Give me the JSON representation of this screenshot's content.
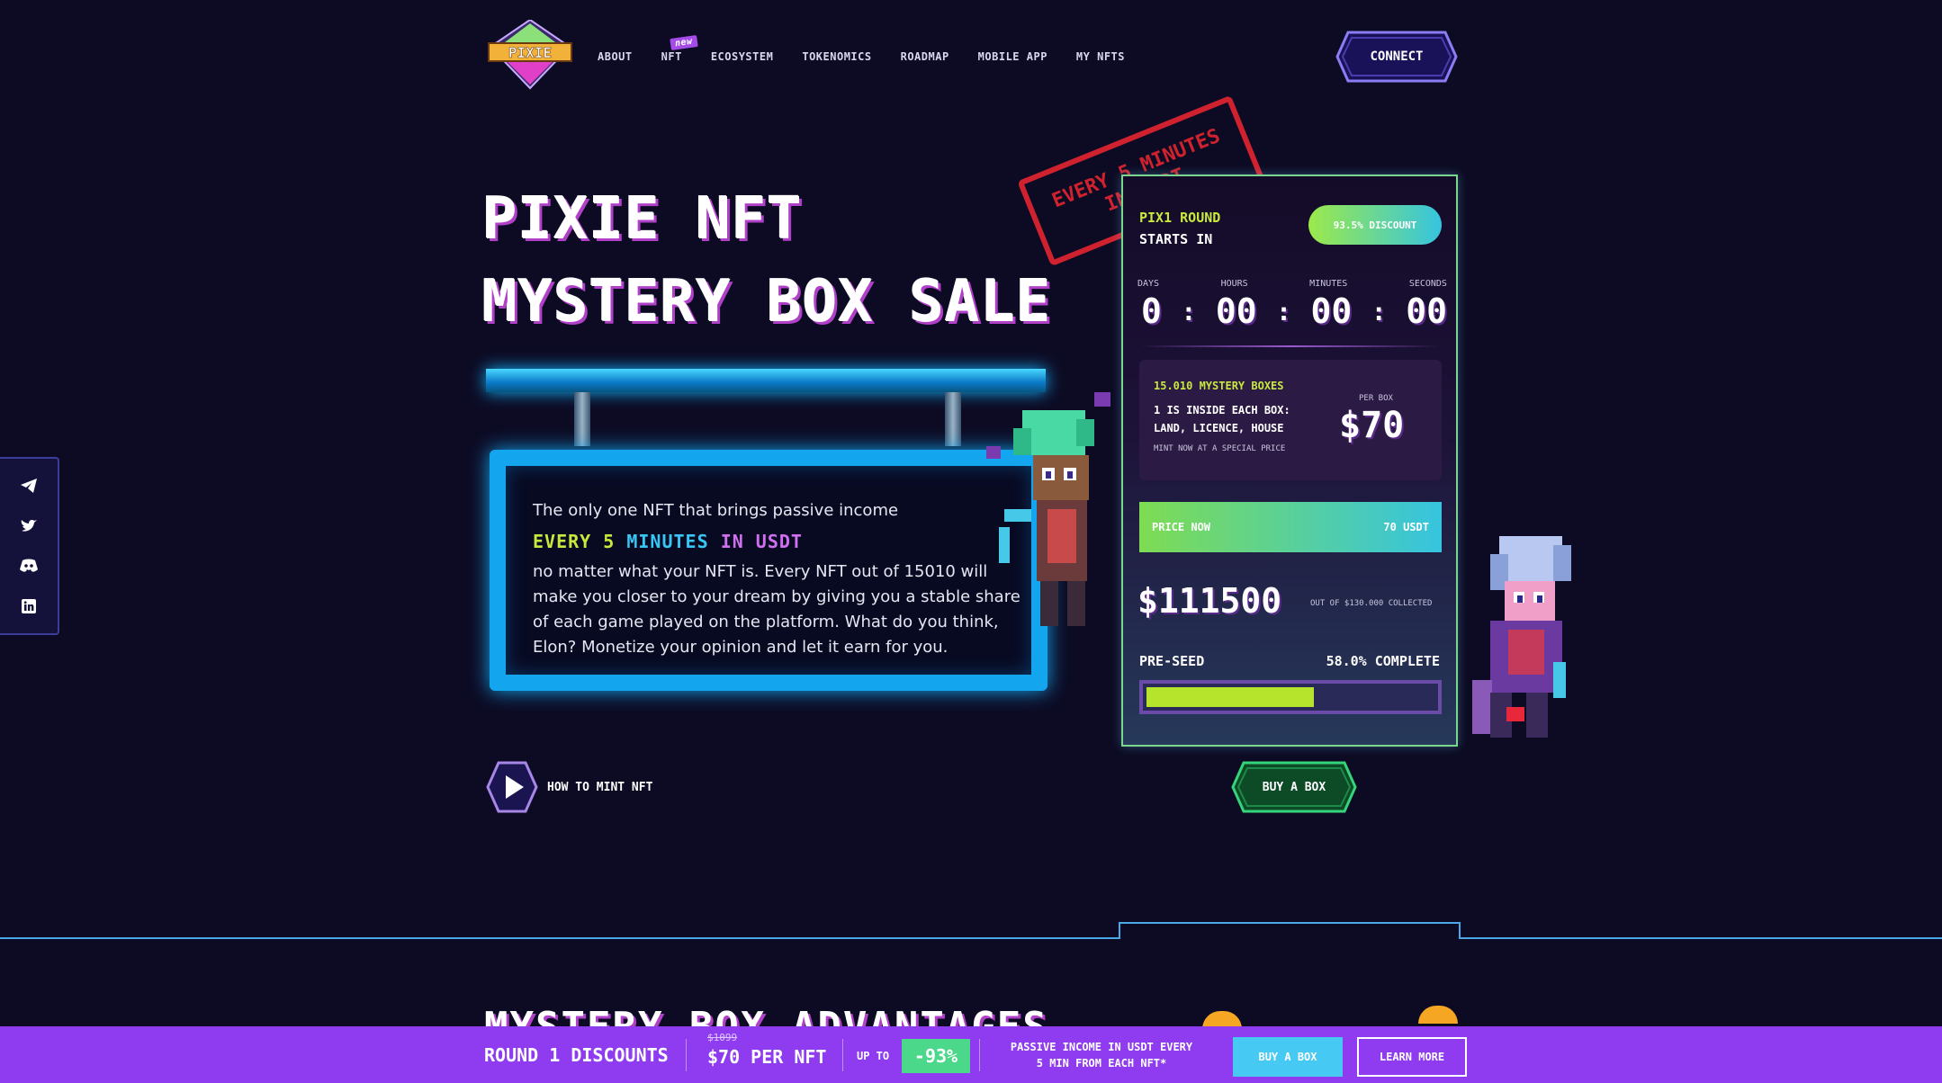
{
  "brand": {
    "logo_text": "PIXIE"
  },
  "nav": {
    "items": [
      {
        "label": "ABOUT"
      },
      {
        "label": "NFT",
        "badge": "new"
      },
      {
        "label": "ECOSYSTEM"
      },
      {
        "label": "TOKENOMICS"
      },
      {
        "label": "ROADMAP"
      },
      {
        "label": "MOBILE APP"
      },
      {
        "label": "MY NFTS"
      }
    ],
    "connect_label": "CONNECT"
  },
  "hero": {
    "title_line1": "PIXIE NFT",
    "title_line2": "MYSTERY BOX SALE",
    "sign_intro": "The only one NFT that brings passive income",
    "sign_highlight": {
      "w1": "EVERY 5",
      "w2": "MINUTES",
      "w3": "IN USDT"
    },
    "sign_body": "no matter what your NFT is. Every NFT out of 15010 will make you closer to your dream by giving you a stable share of each game played on the platform. What do you think, Elon? Monetize your opinion and let it earn for you.",
    "how_label": "HOW TO MINT NFT"
  },
  "stamp": {
    "line1": "EVERY 5 MINUTES",
    "line2": "IN USDT"
  },
  "panel": {
    "round_line1": "PIX1 ROUND",
    "round_line2": "STARTS IN",
    "discount": "93.5% DISCOUNT",
    "countdown": {
      "labels": [
        "DAYS",
        "HOURS",
        "MINUTES",
        "SECONDS"
      ],
      "days": "0",
      "hours": "00",
      "minutes": "00",
      "seconds": "00"
    },
    "box": {
      "count_label": "15.010 MYSTERY BOXES",
      "inside": "1 IS INSIDE EACH BOX: LAND, LICENCE, HOUSE",
      "mint": "MINT NOW AT A SPECIAL PRICE",
      "per_box": "PER BOX",
      "price": "$70"
    },
    "price_now_label": "PRICE NOW",
    "price_now_value": "70 USDT",
    "raised": "$111500",
    "out_of": "OUT OF $130.000 COLLECTED",
    "stage": "PRE-SEED",
    "complete": "58.0% COMPLETE",
    "progress_fraction": 0.58,
    "buy_label": "BUY A BOX"
  },
  "section": {
    "title": "MYSTERY BOX ADVANTAGES"
  },
  "bottom_bar": {
    "round": "ROUND 1 DISCOUNTS",
    "old_price": "$1099",
    "price": "$70 PER NFT",
    "up_to": "UP TO",
    "pct": "-93%",
    "passive_line1": "PASSIVE INCOME IN USDT EVERY",
    "passive_line2": "5 MIN FROM EACH NFT*",
    "buy": "BUY A BOX",
    "learn": "LEARN MORE"
  },
  "social": [
    "telegram-icon",
    "twitter-icon",
    "discord-icon",
    "linkedin-icon"
  ],
  "colors": {
    "bg": "#0d0b24",
    "accent_green": "#c8e83d",
    "accent_cyan": "#13a6ee",
    "accent_purple": "#8f3cf0",
    "stamp_red": "#e52530"
  }
}
